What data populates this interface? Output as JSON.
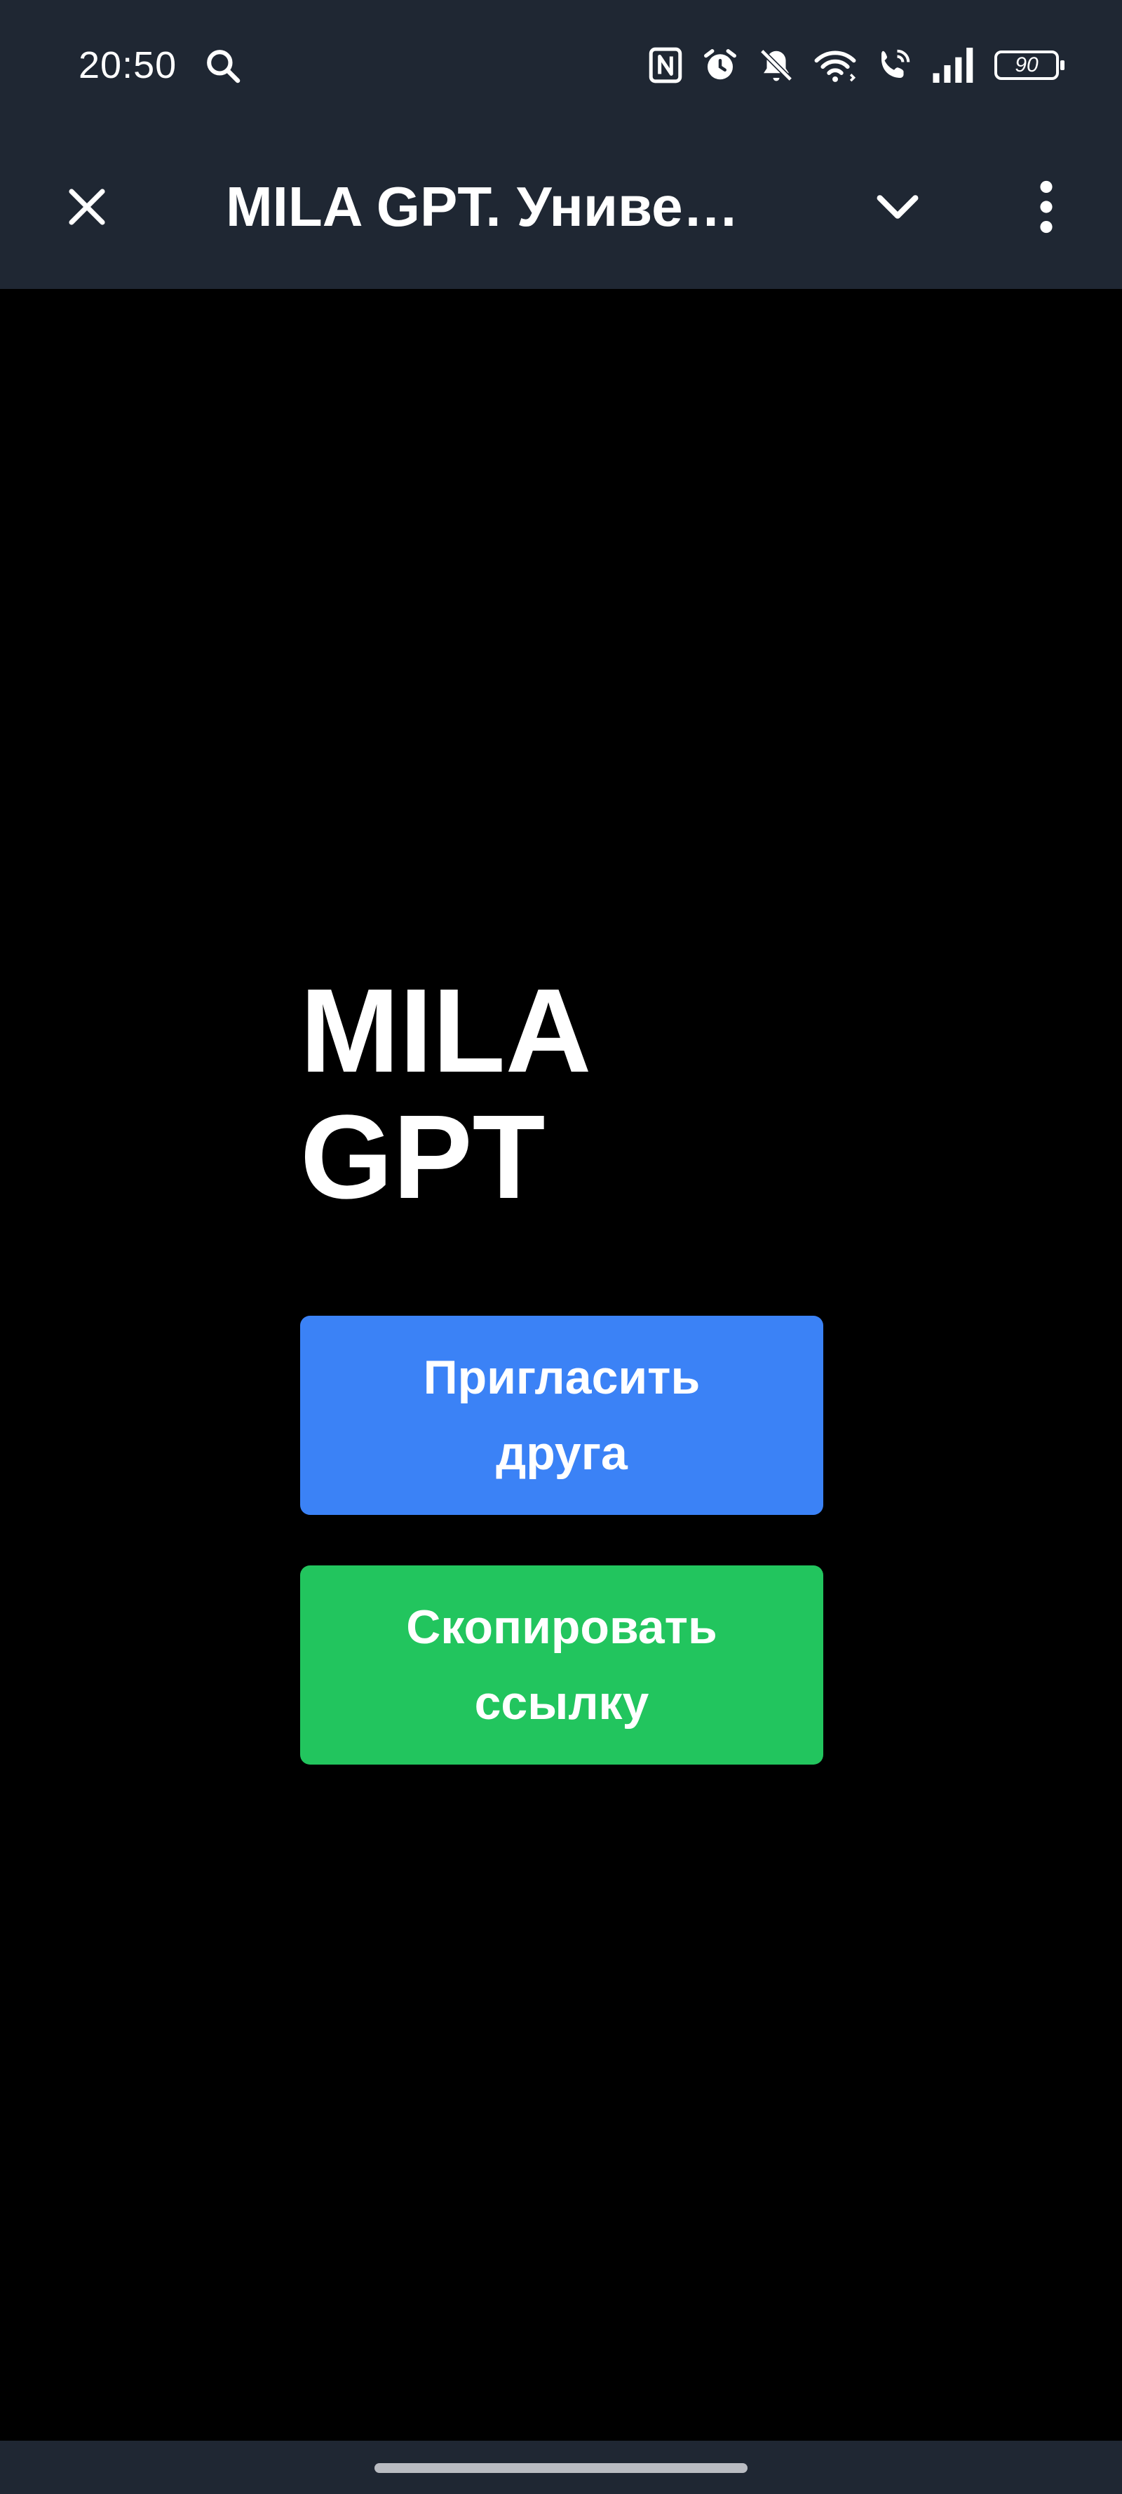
{
  "status_bar": {
    "time": "20:50",
    "battery": "90",
    "icons": [
      "search-icon",
      "nfc-icon",
      "alarm-icon",
      "mute-icon",
      "wifi-icon",
      "wifi-call-icon",
      "signal-icon",
      "battery-icon"
    ]
  },
  "app_bar": {
    "title": "MILA GPT. Униве…",
    "icons": [
      "close-icon",
      "chevron-down-icon",
      "more-vert-icon"
    ]
  },
  "main": {
    "brand_title": "MILA\nGPT",
    "invite_button": "Пригласить друга",
    "copy_button": "Скопировать ссылку"
  },
  "colors": {
    "bar_bg": "#1f2733",
    "page_bg": "#000000",
    "invite": "#3b82f6",
    "copy": "#22c55e"
  }
}
